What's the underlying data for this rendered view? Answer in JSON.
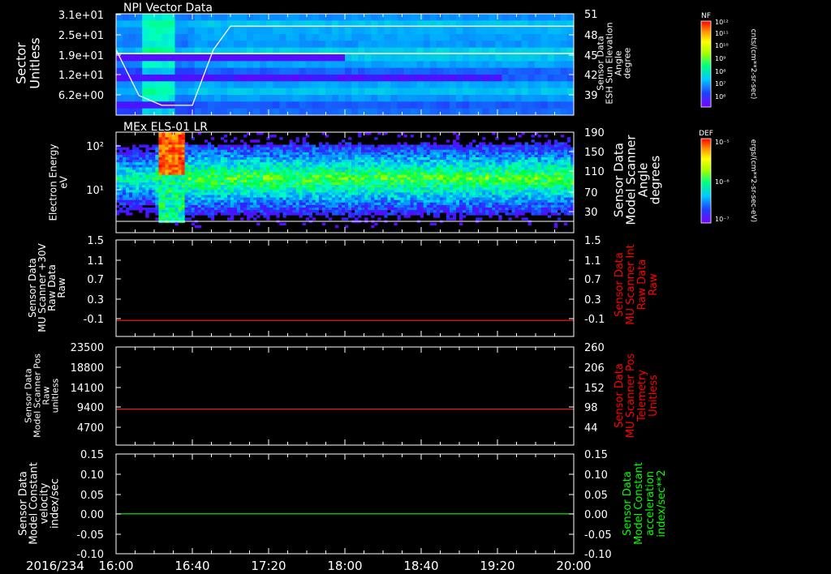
{
  "footer": {
    "date": "2016/234"
  },
  "time_axis": {
    "labels": [
      "16:00",
      "16:40",
      "17:20",
      "18:00",
      "18:40",
      "19:20",
      "20:00"
    ],
    "start": "16:00",
    "end": "20:00"
  },
  "colors": {
    "background": "#000000",
    "axes": "#ffffff",
    "red_label": "#ff0000",
    "green_label": "#00ff00",
    "red_trace": "#ff2020",
    "green_trace": "#00ff00"
  },
  "colorbars": [
    {
      "name": "NF",
      "units": "cnts/(cm**2-sr-sec)",
      "scale": "log",
      "tick_labels": [
        "10¹²",
        "10¹¹",
        "10¹⁰",
        "10⁹",
        "10⁸",
        "10⁷",
        "10⁶"
      ]
    },
    {
      "name": "DEF",
      "units": "ergs/(cm**2-sr-sec-eV)",
      "scale": "log",
      "tick_labels": [
        "10⁻⁵",
        "10⁻⁶",
        "10⁻⁷"
      ]
    }
  ],
  "chart_data": [
    {
      "type": "heatmap",
      "title": "NPI Vector Data",
      "ylabel": [
        "Sector",
        "Unitless"
      ],
      "ylim": [
        0,
        31
      ],
      "yticks": [
        "3.1e+01",
        "2.5e+01",
        "1.9e+01",
        "1.2e+01",
        "6.2e+00"
      ],
      "y2label": [
        "Sensor Data",
        "ESH Sun Elevation",
        "Angle",
        "degree"
      ],
      "y2ticks": [
        "51",
        "48",
        "45",
        "42",
        "39"
      ],
      "colorbar": "NF",
      "overlay_line": {
        "name": "ESH Sun Elevation Angle",
        "color": "#ffffff",
        "x": [
          "16:00",
          "16:12",
          "16:24",
          "16:40",
          "16:51",
          "17:00",
          "20:00"
        ],
        "y": [
          46.0,
          39.0,
          37.5,
          37.5,
          46.0,
          49.6,
          49.6
        ]
      }
    },
    {
      "type": "heatmap",
      "title": "MEx ELS-01 LR",
      "ylabel": [
        "Electron Energy",
        "eV"
      ],
      "scale": "log",
      "ylim": [
        2,
        170
      ],
      "yticks": [
        "10²",
        "10¹"
      ],
      "y2label": [
        "Sensor Data",
        "Model Scanner",
        "Angle",
        "degrees"
      ],
      "y2ticks": [
        "190",
        "150",
        "110",
        "70",
        "30"
      ],
      "colorbar": "DEF"
    },
    {
      "type": "line",
      "ylabel": [
        "Sensor Data",
        "MU Scanner +30V",
        "Raw Data",
        "Raw"
      ],
      "ylim": [
        -0.3,
        1.5
      ],
      "yticks": [
        "1.5",
        "1.1",
        "0.7",
        "0.3",
        "-0.1"
      ],
      "y2label": [
        "Sensor Data",
        "MU Scanner Int",
        "Raw Data",
        "Raw"
      ],
      "y2ticks": [
        "1.5",
        "1.1",
        "0.7",
        "0.3",
        "-0.1"
      ],
      "series": [
        {
          "color": "#ff2020",
          "x": [
            "16:00",
            "20:00"
          ],
          "y": [
            0.0,
            0.0
          ]
        }
      ]
    },
    {
      "type": "line",
      "ylabel": [
        "Sensor Data",
        "Model Scanner Pos",
        "Raw",
        "unitless"
      ],
      "ylim": [
        0,
        23500
      ],
      "yticks": [
        "23500",
        "18800",
        "14100",
        "9400",
        "4700"
      ],
      "y2label": [
        "Sensor Data",
        "MU Scanner Pos",
        "Telemetry",
        "Unitless"
      ],
      "y2ticks": [
        "260",
        "206",
        "152",
        "98",
        "44"
      ],
      "series": [
        {
          "color": "#ff2020",
          "x": [
            "16:00",
            "20:00"
          ],
          "y": [
            8600,
            8600
          ]
        }
      ]
    },
    {
      "type": "line",
      "ylabel": [
        "Sensor Data",
        "Model Constant",
        "velocity",
        "index/sec"
      ],
      "ylim": [
        -0.1,
        0.15
      ],
      "yticks": [
        "0.15",
        "0.10",
        "0.05",
        "0.00",
        "-0.05",
        "-0.10"
      ],
      "y2label": [
        "Sensor Data",
        "Model Constant",
        "acceleration",
        "index/sec**2"
      ],
      "y2ticks": [
        "0.15",
        "0.10",
        "0.05",
        "0.00",
        "-0.05",
        "-0.10"
      ],
      "series": [
        {
          "color": "#00ff00",
          "x": [
            "16:00",
            "20:00"
          ],
          "y": [
            0.0,
            0.0
          ]
        }
      ]
    }
  ]
}
